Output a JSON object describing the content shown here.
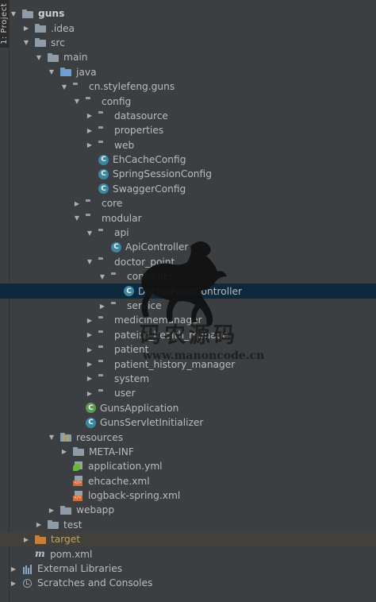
{
  "side_tab": "1: Project",
  "tree": [
    {
      "label": "guns",
      "depth": 0,
      "arrow": "down",
      "icon": "folder",
      "bold": true
    },
    {
      "label": ".idea",
      "depth": 1,
      "arrow": "right",
      "icon": "folder"
    },
    {
      "label": "src",
      "depth": 1,
      "arrow": "down",
      "icon": "folder"
    },
    {
      "label": "main",
      "depth": 2,
      "arrow": "down",
      "icon": "folder"
    },
    {
      "label": "java",
      "depth": 3,
      "arrow": "down",
      "icon": "folder-blue"
    },
    {
      "label": "cn.stylefeng.guns",
      "depth": 4,
      "arrow": "down",
      "icon": "package"
    },
    {
      "label": "config",
      "depth": 5,
      "arrow": "down",
      "icon": "package"
    },
    {
      "label": "datasource",
      "depth": 6,
      "arrow": "right",
      "icon": "package"
    },
    {
      "label": "properties",
      "depth": 6,
      "arrow": "right",
      "icon": "package"
    },
    {
      "label": "web",
      "depth": 6,
      "arrow": "right",
      "icon": "package"
    },
    {
      "label": "EhCacheConfig",
      "depth": 6,
      "arrow": "none",
      "icon": "class"
    },
    {
      "label": "SpringSessionConfig",
      "depth": 6,
      "arrow": "none",
      "icon": "class"
    },
    {
      "label": "SwaggerConfig",
      "depth": 6,
      "arrow": "none",
      "icon": "class"
    },
    {
      "label": "core",
      "depth": 5,
      "arrow": "right",
      "icon": "package"
    },
    {
      "label": "modular",
      "depth": 5,
      "arrow": "down",
      "icon": "package"
    },
    {
      "label": "api",
      "depth": 6,
      "arrow": "down",
      "icon": "package"
    },
    {
      "label": "ApiController",
      "depth": 7,
      "arrow": "none",
      "icon": "class"
    },
    {
      "label": "doctor_point",
      "depth": 6,
      "arrow": "down",
      "icon": "package"
    },
    {
      "label": "controller",
      "depth": 7,
      "arrow": "down",
      "icon": "package"
    },
    {
      "label": "DoctorPointController",
      "depth": 8,
      "arrow": "none",
      "icon": "class",
      "selected": true
    },
    {
      "label": "service",
      "depth": 7,
      "arrow": "right",
      "icon": "package"
    },
    {
      "label": "medicinemanager",
      "depth": 6,
      "arrow": "right",
      "icon": "package"
    },
    {
      "label": "pateint_health_manage",
      "depth": 6,
      "arrow": "right",
      "icon": "package"
    },
    {
      "label": "patient",
      "depth": 6,
      "arrow": "right",
      "icon": "package"
    },
    {
      "label": "patient_history_manager",
      "depth": 6,
      "arrow": "right",
      "icon": "package"
    },
    {
      "label": "system",
      "depth": 6,
      "arrow": "right",
      "icon": "package"
    },
    {
      "label": "user",
      "depth": 6,
      "arrow": "right",
      "icon": "package"
    },
    {
      "label": "GunsApplication",
      "depth": 5,
      "arrow": "none",
      "icon": "class-green"
    },
    {
      "label": "GunsServletInitializer",
      "depth": 5,
      "arrow": "none",
      "icon": "class"
    },
    {
      "label": "resources",
      "depth": 3,
      "arrow": "down",
      "icon": "folder-res"
    },
    {
      "label": "META-INF",
      "depth": 4,
      "arrow": "right",
      "icon": "folder"
    },
    {
      "label": "application.yml",
      "depth": 4,
      "arrow": "none",
      "icon": "yml"
    },
    {
      "label": "ehcache.xml",
      "depth": 4,
      "arrow": "none",
      "icon": "xml"
    },
    {
      "label": "logback-spring.xml",
      "depth": 4,
      "arrow": "none",
      "icon": "xml"
    },
    {
      "label": "webapp",
      "depth": 3,
      "arrow": "right",
      "icon": "folder"
    },
    {
      "label": "test",
      "depth": 2,
      "arrow": "right",
      "icon": "folder"
    },
    {
      "label": "target",
      "depth": 1,
      "arrow": "right",
      "icon": "folder-orange",
      "excluded": true
    },
    {
      "label": "pom.xml",
      "depth": 1,
      "arrow": "none",
      "icon": "pom"
    },
    {
      "label": "External Libraries",
      "depth": 0,
      "arrow": "right",
      "icon": "libs"
    },
    {
      "label": "Scratches and Consoles",
      "depth": 0,
      "arrow": "right",
      "icon": "scratch"
    }
  ],
  "watermark": {
    "title": "码农源码",
    "url": "www.manoncode.cn"
  },
  "colors": {
    "background": "#3c3f41",
    "selection": "#0d293e",
    "text": "#bbbbbb",
    "folder": "#8f9ba6",
    "source_folder": "#6d9fd1",
    "class_icon": "#3e86a0",
    "excluded_folder": "#c77f3b"
  }
}
